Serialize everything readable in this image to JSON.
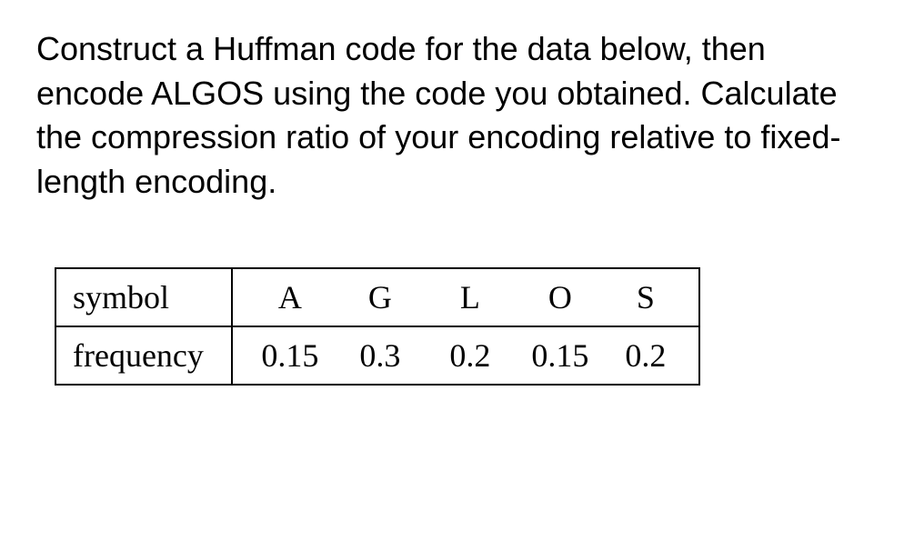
{
  "question": {
    "text": "Construct a Huffman code for the data below, then encode ALGOS using the code you obtained. Calculate the compression ratio of your encoding relative to fixed-length encoding."
  },
  "table": {
    "row_labels": {
      "symbol": "symbol",
      "frequency": "frequency"
    },
    "symbols": {
      "a": "A",
      "g": "G",
      "l": "L",
      "o": "O",
      "s": "S"
    },
    "frequencies": {
      "a": "0.15",
      "g": "0.3",
      "l": "0.2",
      "o": "0.15",
      "s": "0.2"
    }
  }
}
